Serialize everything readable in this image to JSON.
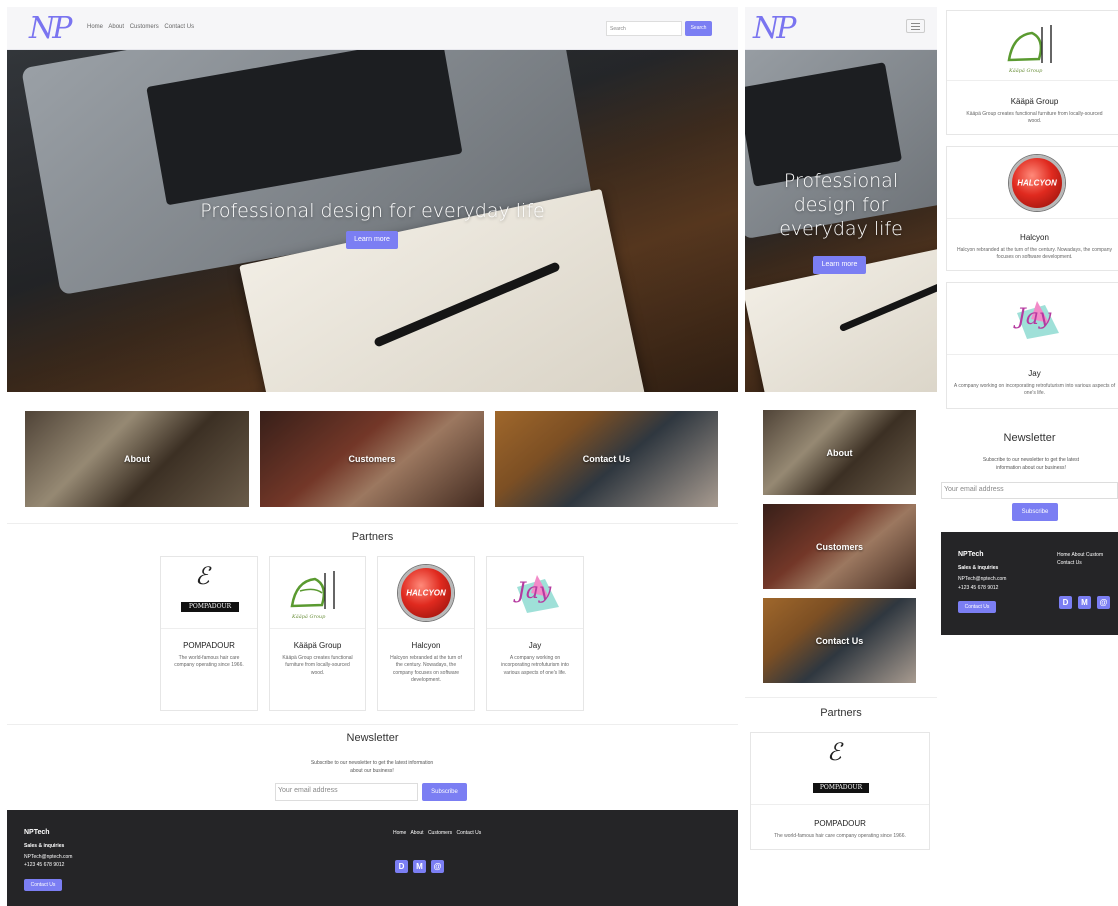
{
  "brand": {
    "logo": "NP",
    "name": "NPTech"
  },
  "nav": {
    "links": [
      "Home",
      "About",
      "Customers",
      "Contact Us"
    ],
    "search_placeholder": "Search",
    "search_button": "Search"
  },
  "hero": {
    "title": "Professional design for everyday life",
    "title_mobile": [
      "Professional",
      "design for",
      "everyday life"
    ],
    "button": "Learn more"
  },
  "tiles": [
    {
      "label": "About"
    },
    {
      "label": "Customers"
    },
    {
      "label": "Contact Us"
    }
  ],
  "partners": {
    "title": "Partners",
    "items": [
      {
        "name": "POMPADOUR",
        "desc": "The world-famous hair care company operating since 1966.",
        "logo_text": "POMPADOUR"
      },
      {
        "name": "Kääpä Group",
        "desc": "Kääpä Group creates functional furniture from locally-sourced wood.",
        "logo_text": "Kääpä Group"
      },
      {
        "name": "Halcyon",
        "desc": "Halcyon rebranded at the turn of the century. Nowadays, the company focuses on software development.",
        "logo_text": "HALCYON"
      },
      {
        "name": "Jay",
        "desc": "A company working on incorporating retrofuturism into various aspects of one's life.",
        "logo_text": "Jay"
      }
    ]
  },
  "newsletter": {
    "title": "Newsletter",
    "text": "Subscribe to our newsletter to get the latest information about our business!",
    "placeholder": "Your email address",
    "button": "Subscribe"
  },
  "footer": {
    "brand": "NPTech",
    "sales_title": "Sales & inquiries",
    "email": "NPTech@nptech.com",
    "phone": "+123 45 678 9012",
    "contact_button": "Contact Us",
    "links": [
      "Home",
      "About",
      "Customers",
      "Contact Us"
    ],
    "links_m2_top": "Home  About  Custom",
    "links_m2_bottom": "Contact Us",
    "social": [
      "D",
      "M",
      "@"
    ]
  },
  "colors": {
    "accent": "#7b7ef3",
    "footer_bg": "#252527",
    "nav_bg": "#f6f6f8"
  }
}
